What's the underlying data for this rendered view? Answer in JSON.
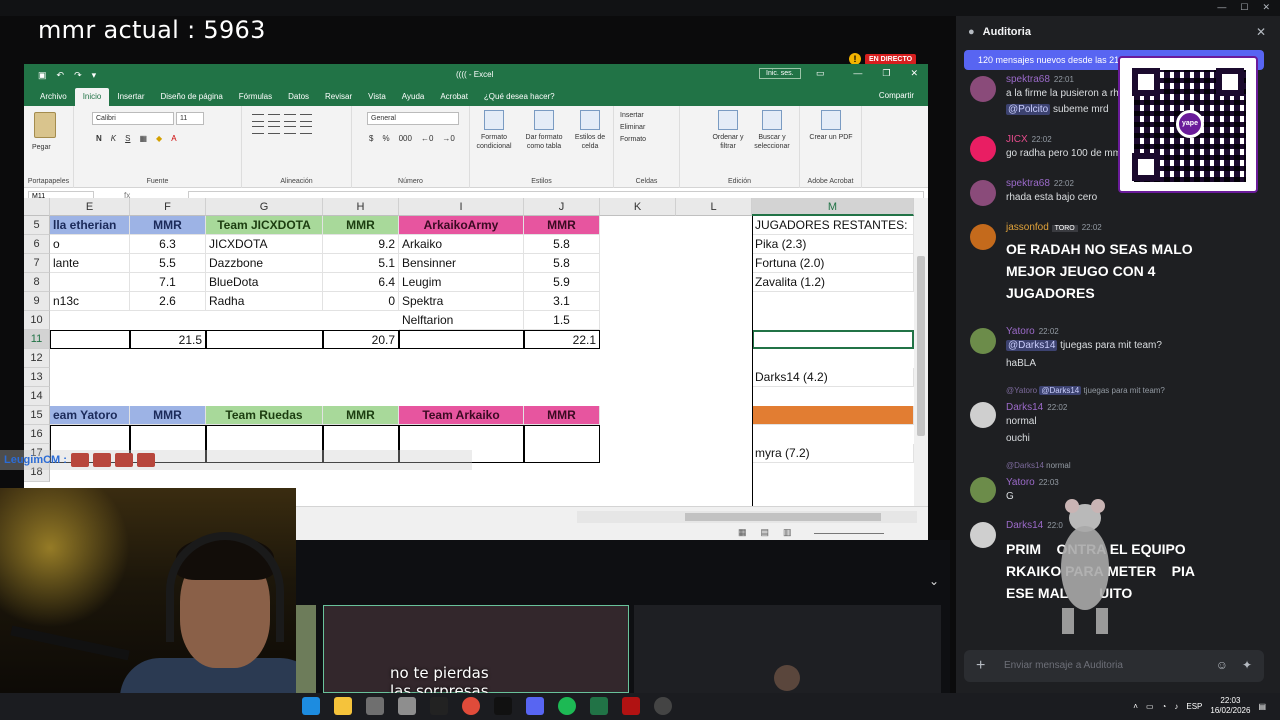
{
  "stream": {
    "mmr_text": "mmr actual : 5963",
    "live_badge": "EN DIRECTO",
    "subtitle_line1": "no te pierdas",
    "subtitle_line2": "las sorpresas",
    "overlay_chat_user": "LeugimCM :"
  },
  "excel": {
    "file_name": "(((( - Excel",
    "login": "Inic. ses.",
    "tabs": [
      "Archivo",
      "Inicio",
      "Insertar",
      "Diseño de página",
      "Fórmulas",
      "Datos",
      "Revisar",
      "Vista",
      "Ayuda",
      "Acrobat",
      "¿Qué desea hacer?"
    ],
    "active_tab": "Inicio",
    "share": "Compartir",
    "ribbon": {
      "paste": "Pegar",
      "clipboard_group": "Portapapeles",
      "font_name": "Calibri",
      "font_size": "11",
      "font_group": "Fuente",
      "align_group": "Alineación",
      "number_format": "General",
      "number_group": "Número",
      "styles_group": "Estilos",
      "cond_format": "Formato condicional",
      "table_format": "Dar formato como tabla",
      "cell_styles": "Estilos de celda",
      "insert": "Insertar",
      "delete": "Eliminar",
      "format": "Formato",
      "cells_group": "Celdas",
      "sort_filter": "Ordenar y filtrar",
      "find_select": "Buscar y seleccionar",
      "edit_group": "Edición",
      "create_pdf": "Crear un PDF",
      "acrobat_group": "Adobe Acrobat"
    },
    "name_box": "M11",
    "fx": "fx",
    "columns": [
      "E",
      "F",
      "G",
      "H",
      "I",
      "J",
      "K",
      "L",
      "M"
    ],
    "rows": [
      "5",
      "6",
      "7",
      "8",
      "9",
      "10",
      "11",
      "12",
      "13",
      "14",
      "15",
      "16",
      "17",
      "18"
    ],
    "table1": {
      "headers": [
        "lla etherian",
        "MMR",
        "Team JICXDOTA",
        "MMR",
        "ArkaikoArmy",
        "MMR"
      ],
      "r6": [
        "o",
        "6.3",
        "JICXDOTA",
        "9.2",
        "Arkaiko",
        "5.8"
      ],
      "r7": [
        "lante",
        "5.5",
        "Dazzbone",
        "5.1",
        "Bensinner",
        "5.8"
      ],
      "r8": [
        "",
        "7.1",
        "BlueDota",
        "6.4",
        "Leugim",
        "5.9"
      ],
      "r9": [
        "n13c",
        "2.6",
        "Radha",
        "0",
        "Spektra",
        "3.1"
      ],
      "r10": [
        "",
        "",
        "",
        "",
        "Nelftarion",
        "1.5"
      ],
      "totals": [
        "21.5",
        "20.7",
        "22.1"
      ]
    },
    "table2": {
      "headers": [
        "eam Yatoro",
        "MMR",
        "Team Ruedas",
        "MMR",
        "Team Arkaiko",
        "MMR"
      ]
    },
    "remaining": {
      "title": "JUGADORES RESTANTES:",
      "p1": "Pika (2.3)",
      "p2": "Fortuna (2.0)",
      "p3": "Zavalita (1.2)",
      "p4": "Darks14 (4.2)",
      "p5": "myra (7.2)"
    }
  },
  "chat": {
    "title": "Auditoria",
    "new_messages": "120 mensajes nuevos desde las 21:3",
    "messages": [
      {
        "user": "spektra68",
        "time": "22:01",
        "text": "a la firme la pusieron a rh"
      },
      {
        "mention": "@Polcito",
        "text": "subeme mrd"
      },
      {
        "user": "JICX",
        "time": "22:02",
        "text": "go radha pero 100 de mm"
      },
      {
        "user": "spektra68",
        "time": "22:02",
        "text": "rhada esta bajo cero"
      },
      {
        "user": "jassonfod",
        "badge": "TORO",
        "time": "22:02",
        "text": "OE RADAH NO SEAS MALO MEJOR JEUGO CON 4 JUGADORES"
      },
      {
        "user": "Yatoro",
        "time": "22:02",
        "mention": "@Darks14",
        "text": "tjuegas para mit team?",
        "text2": "haBLA"
      },
      {
        "reply_user": "@Yatoro",
        "reply_mention": "@Darks14",
        "reply_text": "tjuegas para mit team?",
        "user": "Darks14",
        "time": "22:02",
        "text": "normal",
        "text2": "ouchi"
      },
      {
        "reply_user": "@Darks14",
        "reply_text": "normal",
        "user": "Yatoro",
        "time": "22:03",
        "text": "G"
      },
      {
        "user": "Darks14",
        "time": "22:0",
        "text": "PRIM    ONTRA EL EQUIPO    RKAIKO PARA METER    PIA  ESE MAL        UITO"
      }
    ],
    "composer_placeholder": "Enviar mensaje a Auditoria"
  },
  "taskbar": {
    "lang": "ESP",
    "time": "22:03",
    "date": "16/02/2026"
  },
  "colors": {
    "excel_green": "#217346",
    "header_blue": "#9db3e5",
    "header_green": "#a8d99a",
    "header_pink": "#e7559f",
    "orange_fill": "#e27d32",
    "discord_blurple": "#5865f2"
  }
}
